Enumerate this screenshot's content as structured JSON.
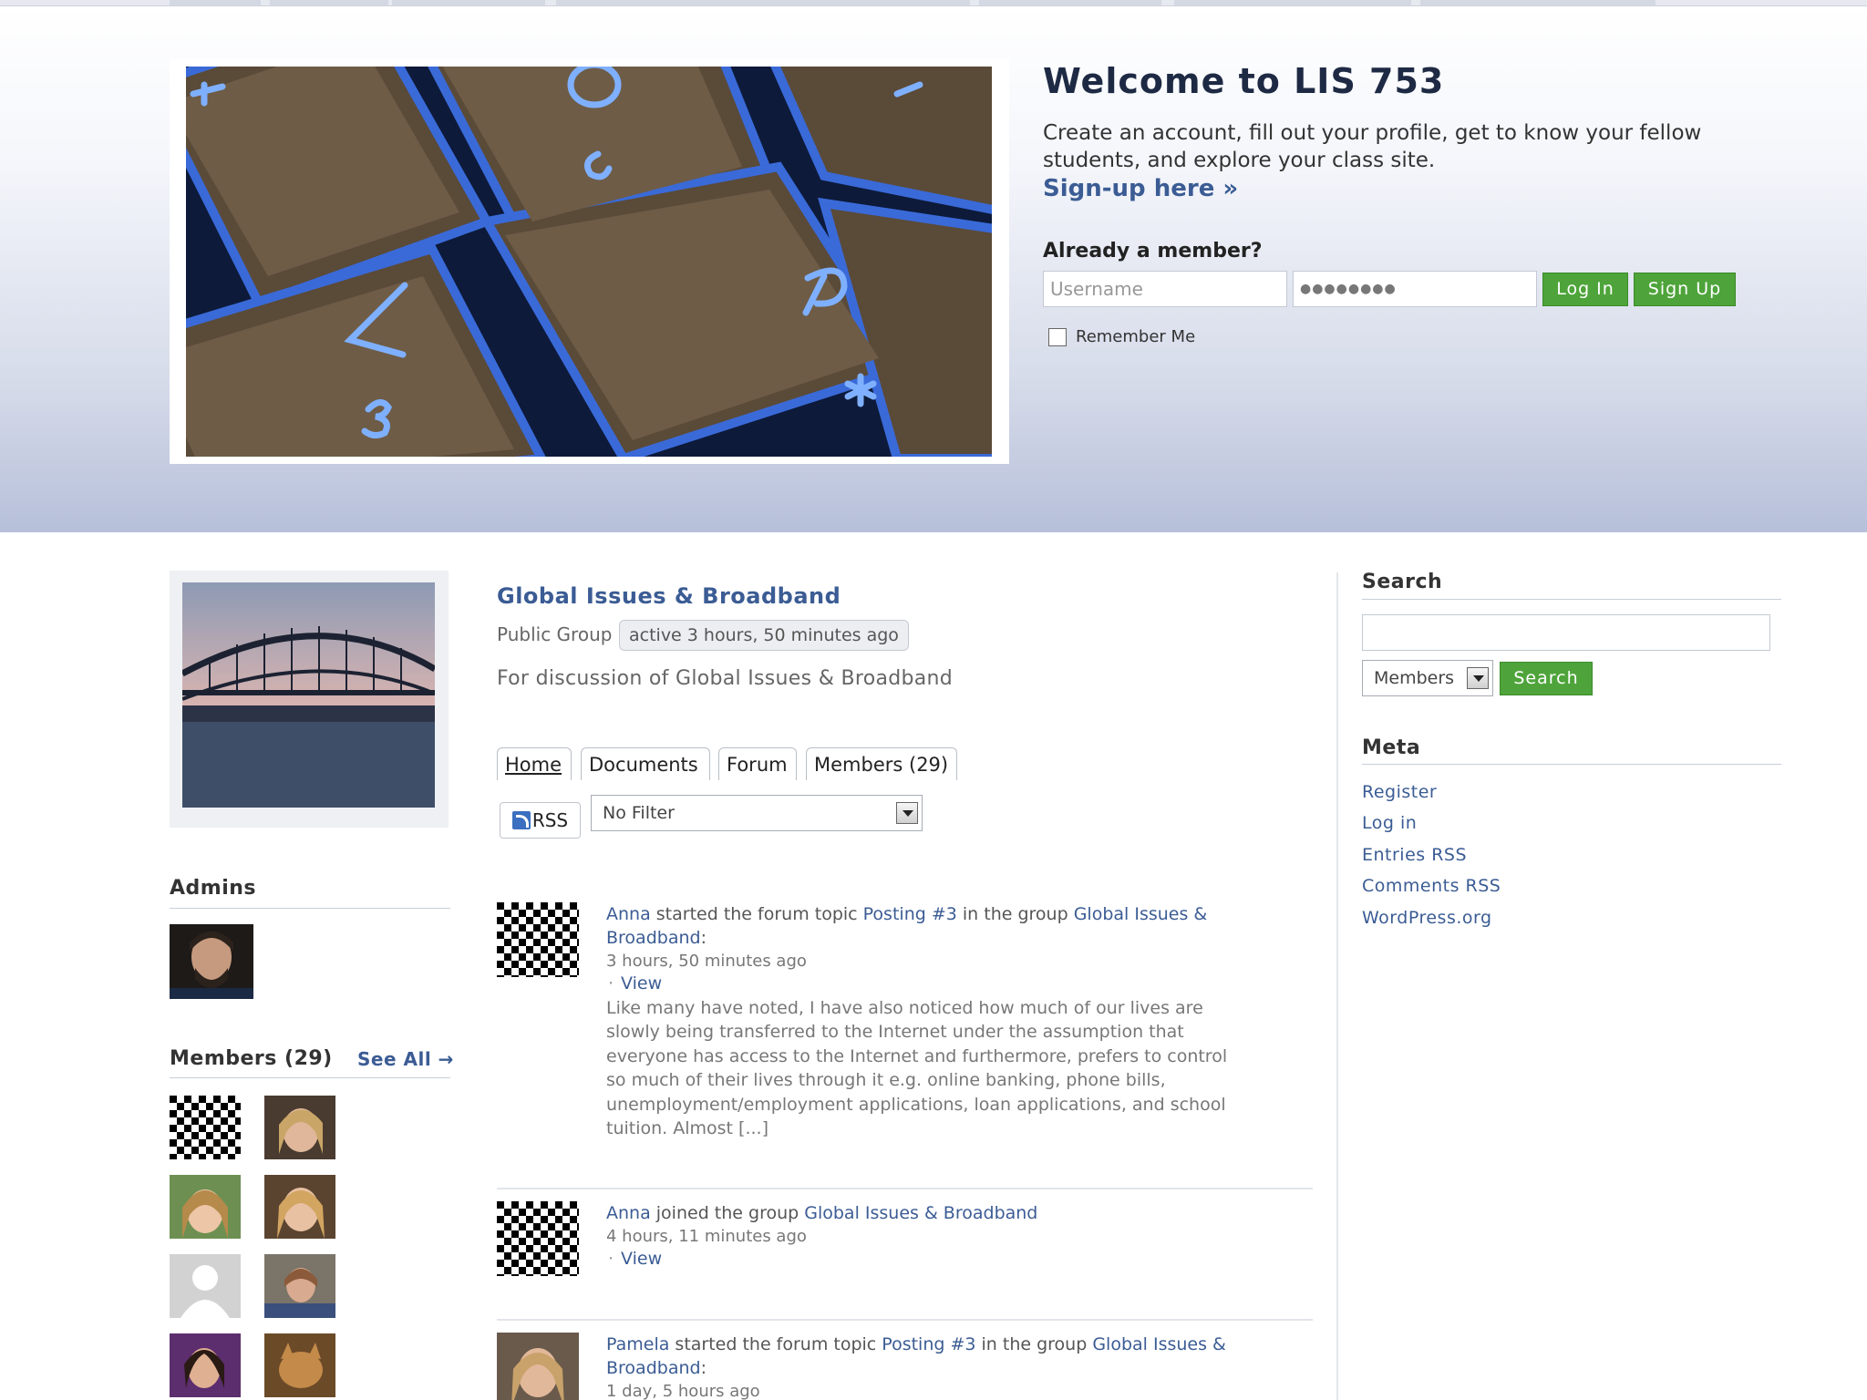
{
  "header": {
    "welcome_title": "Welcome to LIS 753",
    "intro": "Create an account, fill out your profile, get to know your fellow students, and explore your class site.",
    "signup_link": "Sign-up here »",
    "already_member": "Already a member?",
    "username_placeholder": "Username",
    "password_mask": "●●●●●●●●",
    "login_button": "Log In",
    "signup_button": "Sign Up",
    "remember_me": "Remember Me"
  },
  "group": {
    "title": "Global Issues & Broadband",
    "type": "Public Group",
    "active": "active 3 hours, 50 minutes ago",
    "description": "For discussion of Global Issues & Broadband",
    "tabs": [
      "Home",
      "Documents",
      "Forum",
      "Members (29)"
    ],
    "rss_label": "RSS",
    "filter_value": "No Filter"
  },
  "sidebar_left": {
    "admins_heading": "Admins",
    "members_heading": "Members (29)",
    "see_all": "See All →"
  },
  "activity": [
    {
      "user": "Anna",
      "action": " started the forum topic ",
      "topic": "Posting #3",
      "middle": " in the group ",
      "group": "Global Issues & Broadband",
      "suffix": ":",
      "time": "3 hours, 50 minutes ago",
      "view": "View",
      "excerpt": "Like many have noted, I have also noticed how much of our lives are slowly being transferred to the Internet under the assumption that everyone has access to the Internet and furthermore, prefers to control so much of their lives through it e.g. online banking, phone bills, unemployment/employment applications, loan applications, and school tuition. Almost [...]"
    },
    {
      "user": "Anna",
      "action": " joined the group ",
      "group": "Global Issues & Broadband",
      "time": "4 hours, 11 minutes ago",
      "view": "View"
    },
    {
      "user": "Pamela",
      "action": " started the forum topic ",
      "topic": "Posting #3",
      "middle": " in the group ",
      "group": "Global Issues & Broadband",
      "suffix": ":",
      "time": "1 day, 5 hours ago"
    }
  ],
  "sidebar_right": {
    "search_heading": "Search",
    "search_scope": "Members",
    "search_button": "Search",
    "meta_heading": "Meta",
    "meta_links": [
      "Register",
      "Log in",
      "Entries RSS",
      "Comments RSS",
      "WordPress.org"
    ]
  },
  "icons": [
    "rss-icon",
    "dropdown-arrow-icon",
    "checkbox-icon"
  ],
  "colors": {
    "link": "#3b5c94",
    "button_green": "#4ea43a",
    "header_gradient_bottom": "#b7c0da"
  }
}
